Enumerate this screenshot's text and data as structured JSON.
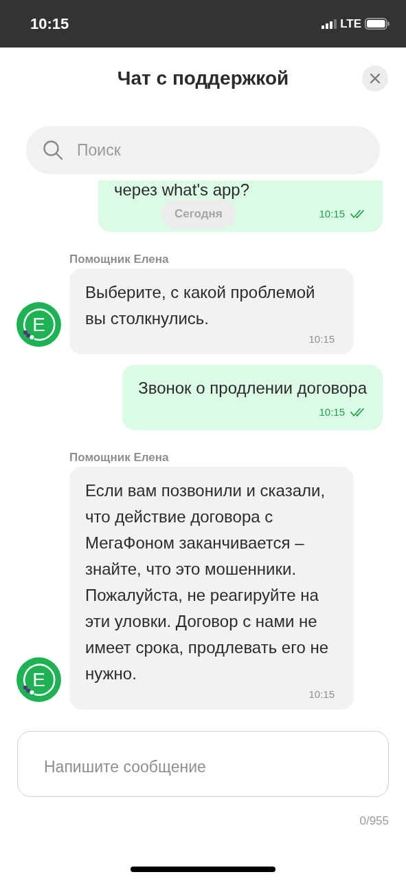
{
  "status_bar": {
    "time": "10:15",
    "network": "LTE"
  },
  "header": {
    "title": "Чат с поддержкой"
  },
  "search": {
    "placeholder": "Поиск"
  },
  "date_divider": "Сегодня",
  "messages": [
    {
      "kind": "outgoing",
      "text": "через what's app?",
      "time": "10:15",
      "read": true
    },
    {
      "kind": "incoming",
      "sender": "Помощник Елена",
      "avatar": "E",
      "text": "Выберите, с какой проблемой вы столкнулись.",
      "time": "10:15"
    },
    {
      "kind": "outgoing",
      "text": "Звонок о продлении договора",
      "time": "10:15",
      "read": true
    },
    {
      "kind": "incoming",
      "sender": "Помощник Елена",
      "avatar": "E",
      "text": "Если вам позвонили и сказали, что действие договора с МегаФоном заканчивается – знайте, что это мошенники. Пожалуйста, не реагируйте на эти уловки. Договор с нами не имеет срока, продлевать его не нужно.",
      "time": "10:15"
    }
  ],
  "composer": {
    "placeholder": "Напишите сообщение",
    "counter": "0/955"
  }
}
